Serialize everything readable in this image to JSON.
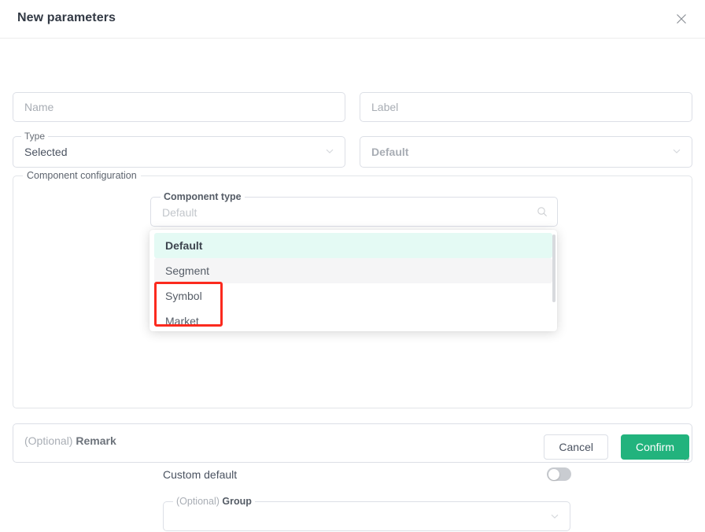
{
  "header": {
    "title": "New parameters",
    "close_icon": "close-icon"
  },
  "form": {
    "name_placeholder": "Name",
    "label_placeholder": "Label",
    "type_legend": "Type",
    "type_value": "Selected",
    "default_placeholder": "Default"
  },
  "component_configuration": {
    "legend": "Component configuration",
    "component_type_legend": "Component type",
    "component_type_placeholder": "Default",
    "search_icon": "search-icon",
    "dropdown": {
      "options": [
        {
          "label": "Default",
          "state": "selected"
        },
        {
          "label": "Segment",
          "state": "hovered"
        },
        {
          "label": "Symbol",
          "state": "normal"
        },
        {
          "label": "Market",
          "state": "normal"
        }
      ],
      "highlight_color": "#e4faf4",
      "hover_color": "#f5f5f6"
    },
    "annotation": {
      "color": "#fb2a1e",
      "covers": [
        "Symbol",
        "Market"
      ]
    },
    "custom_default_label": "Custom default",
    "custom_default_on": false,
    "group_legend_optional": "(Optional)",
    "group_legend_name": "Group",
    "group_value": ""
  },
  "remark": {
    "placeholder_optional": "(Optional)",
    "placeholder_name": "Remark",
    "value": ""
  },
  "footer": {
    "cancel_label": "Cancel",
    "confirm_label": "Confirm",
    "confirm_color": "#22b37d"
  }
}
